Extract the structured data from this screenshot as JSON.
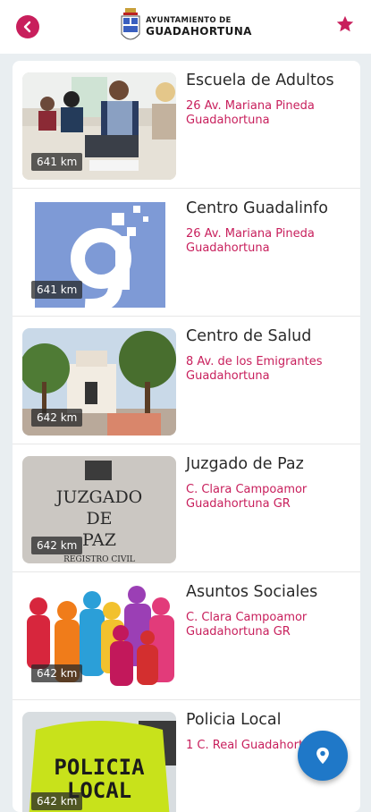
{
  "header": {
    "logo_line1": "AYUNTAMIENTO DE",
    "logo_line2": "GUADAHORTUNA",
    "accent": "#c81f5c"
  },
  "icons": {
    "back": "chevron-left-icon",
    "favorite": "star-icon",
    "map": "location-pin-icon"
  },
  "items": [
    {
      "title": "Escuela de Adultos",
      "address1": "26 Av. Mariana Pineda",
      "address2": "Guadahortuna",
      "distance": "641 km"
    },
    {
      "title": "Centro Guadalinfo",
      "address1": "26 Av. Mariana Pineda",
      "address2": "Guadahortuna",
      "distance": "641 km"
    },
    {
      "title": "Centro de Salud",
      "address1": "8 Av. de los Emigrantes",
      "address2": "Guadahortuna",
      "distance": "642 km"
    },
    {
      "title": "Juzgado de Paz",
      "address1": "C. Clara Campoamor",
      "address2": "Guadahortuna GR",
      "distance": "642 km"
    },
    {
      "title": "Asuntos Sociales",
      "address1": "C. Clara Campoamor",
      "address2": "Guadahortuna GR",
      "distance": "642 km"
    },
    {
      "title": "Policia Local",
      "address1": "1 C. Real Guadahortuna",
      "address2": "",
      "distance": "642 km"
    }
  ],
  "images": {
    "juzgado_sign": [
      "JUZGADO",
      "DE",
      "PAZ",
      "REGISTRO CIVIL"
    ],
    "policia_vest": [
      "POLICIA",
      "LOCAL"
    ]
  }
}
